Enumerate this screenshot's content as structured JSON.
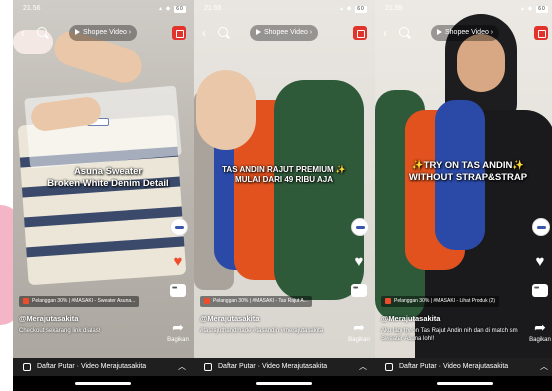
{
  "status_time": "21.56",
  "status_time_2": "21.55",
  "status_time_3": "21.55",
  "battery": "60",
  "pill_label": "Shopee Video",
  "phones": [
    {
      "overlay": "Asuna Sweater\nBroken White Denim Detail",
      "product": "Pelanggan 30% | #MASAKI - Sweater Asuna...",
      "username": "@Merajutasakita",
      "caption": "Checkout sekarang link dialas!"
    },
    {
      "overlay": "TAS ANDIN RAJUT PREMIUM ✨\nMULAI DARI 49 RIBU AJA",
      "product": "Pelanggan 30% | #MASAKI - Tas Rajut A...",
      "username": "@Merajutasakita",
      "caption": "#tasrajuthandmade #tasandin #merajutasakita"
    },
    {
      "overlay": "✨TRY ON TAS ANDIN✨\nWITHOUT STRAP&STRAP",
      "product": "Pelanggan 30% | #MASAKI - Lihat Produk (2)",
      "username": "@Merajutasakita",
      "caption": "Aku lagi try on Tas Rajut Andin nih dan di match sm Sweater Asuna loh!!"
    }
  ],
  "share_label": "Bagikan",
  "playlist_label": "Daftar Putar · Video Merajutasakita",
  "icons": {
    "back": "chevron-left-icon",
    "search": "search-icon",
    "play": "play-icon",
    "record": "record-icon",
    "heart": "heart-icon",
    "comment": "comment-icon",
    "share": "share-arrow-icon",
    "bag": "shopping-bag-icon",
    "playlist": "playlist-icon"
  },
  "colors": {
    "accent": "#ee4d2d",
    "record": "#e2322c",
    "pink": "#f4b6c6"
  }
}
